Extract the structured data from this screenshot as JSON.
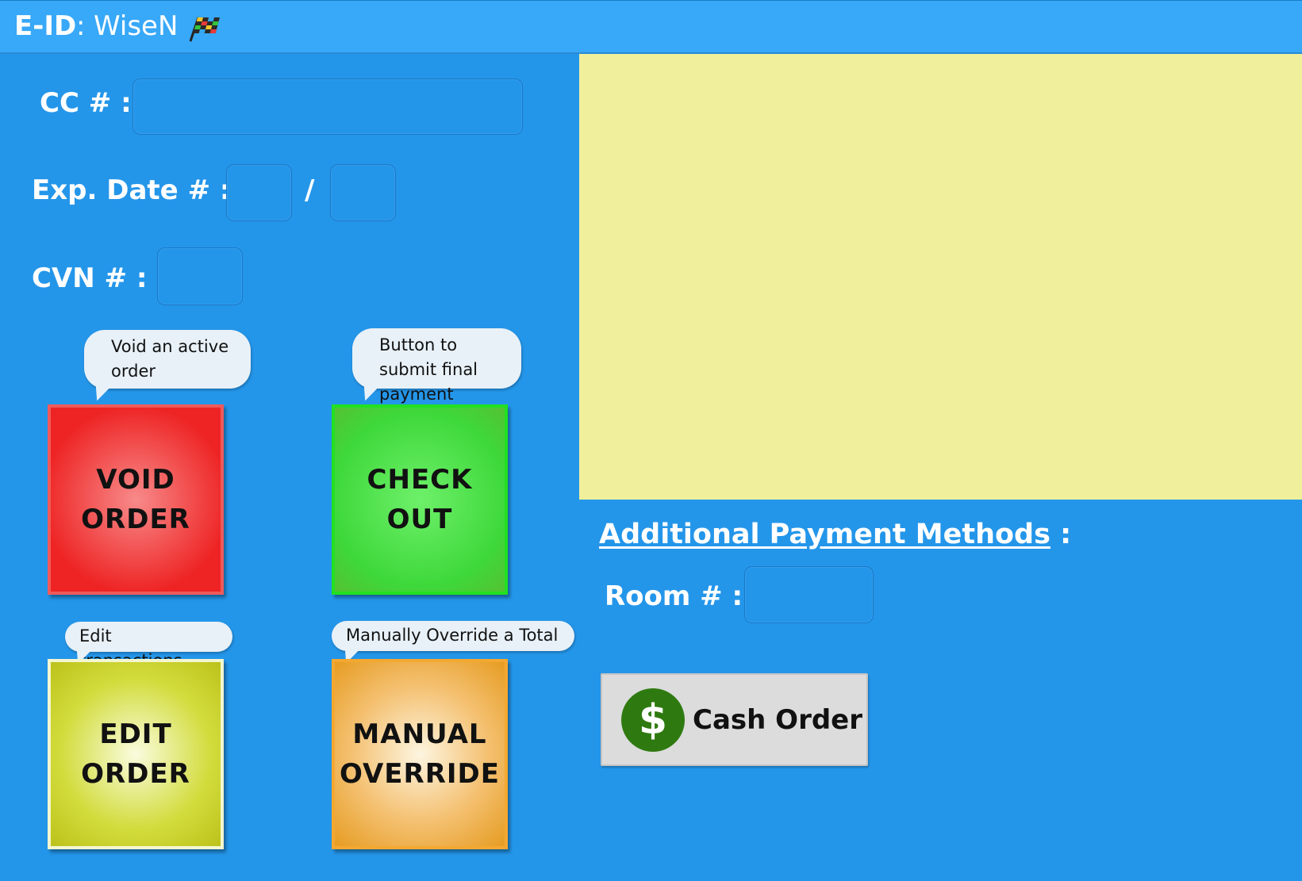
{
  "titlebar": {
    "eid_label": "E-ID",
    "separator": ":",
    "user_name": "WiseN",
    "icon": "checkered-flag-icon"
  },
  "card_form": {
    "cc_label": "CC # :",
    "cc_value": "",
    "exp_label": "Exp. Date # :",
    "exp_month": "",
    "exp_separator": "/",
    "exp_year": "",
    "cvn_label": "CVN # :",
    "cvn_value": ""
  },
  "actions": {
    "void": {
      "tooltip": "Void an active order",
      "label": "VOID\nORDER",
      "color": "#ee2424"
    },
    "checkout": {
      "tooltip": "Button to submit final payment",
      "label": "CHECK\nOUT",
      "color": "#3ed83a"
    },
    "edit": {
      "tooltip": "Edit transactions",
      "label": "EDIT\nORDER",
      "color": "#d2dc3c"
    },
    "manual": {
      "tooltip": "Manually Override a Total",
      "label": "MANUAL\nOVERRIDE",
      "color": "#e69c22"
    }
  },
  "display_panel": {
    "color": "#f0f09c"
  },
  "additional": {
    "title": "Additional Payment Methods",
    "title_suffix": " :",
    "room_label": "Room # :",
    "room_value": "",
    "cash_label": "Cash Order",
    "cash_icon": "dollar-sign-icon",
    "cash_icon_glyph": "$"
  },
  "colors": {
    "background": "#2496ea",
    "titlebar": "#38a8f8"
  }
}
